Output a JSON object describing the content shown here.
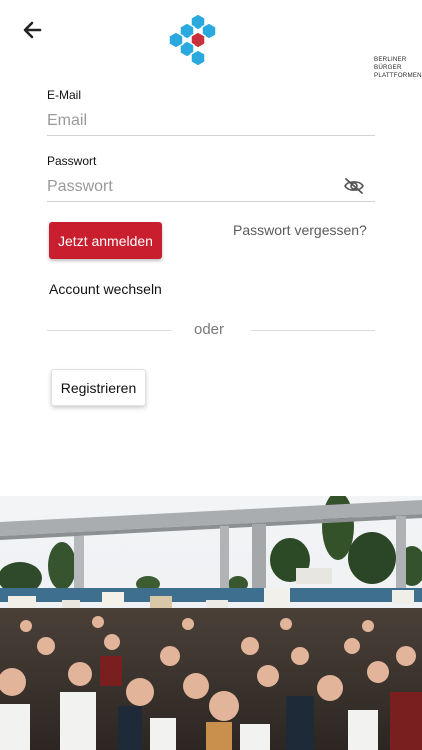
{
  "header": {
    "back_icon": "arrow-left-icon",
    "logo": {
      "lines": [
        "BERLINER",
        "BÜRGER",
        "PLATTFORMEN"
      ],
      "hex_blue": "#2aa9df",
      "hex_red": "#c8313b"
    }
  },
  "form": {
    "email": {
      "label": "E-Mail",
      "placeholder": "Email",
      "value": ""
    },
    "password": {
      "label": "Passwort",
      "placeholder": "Passwort",
      "value": "",
      "toggle_icon": "eye-off-icon"
    }
  },
  "actions": {
    "login_label": "Jetzt anmelden",
    "forgot_label": "Passwort vergessen?",
    "switch_account_label": "Account wechseln",
    "divider_label": "oder",
    "register_label": "Registrieren"
  },
  "theme": {
    "accent": "#c81e2e",
    "text": "#111111",
    "muted": "#9a9a9a"
  }
}
